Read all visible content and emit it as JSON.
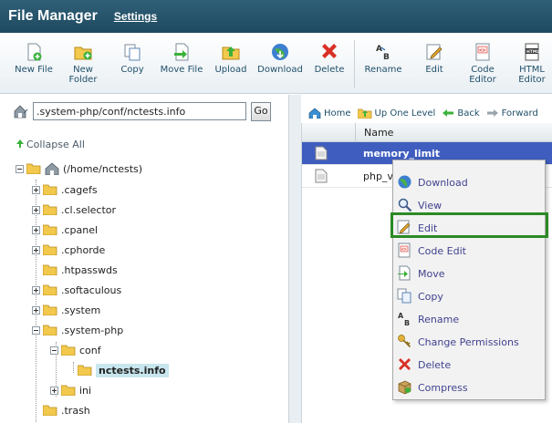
{
  "header": {
    "title": "File Manager",
    "settings_label": "Settings"
  },
  "toolbar": {
    "buttons": [
      {
        "label": "New File",
        "icon": "new-file-icon"
      },
      {
        "label": "New Folder",
        "icon": "new-folder-icon"
      },
      {
        "label": "Copy",
        "icon": "copy-icon"
      },
      {
        "label": "Move File",
        "icon": "move-file-icon"
      },
      {
        "label": "Upload",
        "icon": "upload-icon"
      },
      {
        "label": "Download",
        "icon": "download-icon"
      },
      {
        "label": "Delete",
        "icon": "delete-icon"
      },
      {
        "label": "Rename",
        "icon": "rename-icon"
      },
      {
        "label": "Edit",
        "icon": "edit-icon"
      },
      {
        "label": "Code Editor",
        "icon": "code-editor-icon"
      },
      {
        "label": "HTML Editor",
        "icon": "html-editor-icon"
      }
    ]
  },
  "pathbar": {
    "path": ".system-php/conf/nctests.info",
    "go_label": "Go"
  },
  "tree": {
    "collapse_label": "Collapse All",
    "root_label": "(/home/nctests)",
    "items": [
      {
        "label": ".cagefs"
      },
      {
        "label": ".cl.selector"
      },
      {
        "label": ".cpanel"
      },
      {
        "label": ".cphorde"
      },
      {
        "label": ".htpasswds"
      },
      {
        "label": ".softaculous"
      },
      {
        "label": ".system"
      },
      {
        "label": ".system-php"
      },
      {
        "label": "conf"
      },
      {
        "label": "nctests.info"
      },
      {
        "label": "ini"
      },
      {
        "label": ".trash"
      }
    ]
  },
  "nav": {
    "home_label": "Home",
    "up_label": "Up One Level",
    "back_label": "Back",
    "forward_label": "Forward"
  },
  "filelist": {
    "column_name": "Name",
    "rows": [
      {
        "name": "memory_limit",
        "selected": true
      },
      {
        "name": "php_ve",
        "selected": false
      }
    ]
  },
  "context_menu": {
    "items": [
      {
        "label": "Download",
        "icon": "download-icon"
      },
      {
        "label": "View",
        "icon": "view-icon"
      },
      {
        "label": "Edit",
        "icon": "edit-icon"
      },
      {
        "label": "Code Edit",
        "icon": "code-edit-icon"
      },
      {
        "label": "Move",
        "icon": "move-icon"
      },
      {
        "label": "Copy",
        "icon": "copy-icon"
      },
      {
        "label": "Rename",
        "icon": "rename-icon"
      },
      {
        "label": "Change Permissions",
        "icon": "key-icon"
      },
      {
        "label": "Delete",
        "icon": "delete-icon"
      },
      {
        "label": "Compress",
        "icon": "compress-icon"
      }
    ],
    "highlighted": "Edit"
  }
}
